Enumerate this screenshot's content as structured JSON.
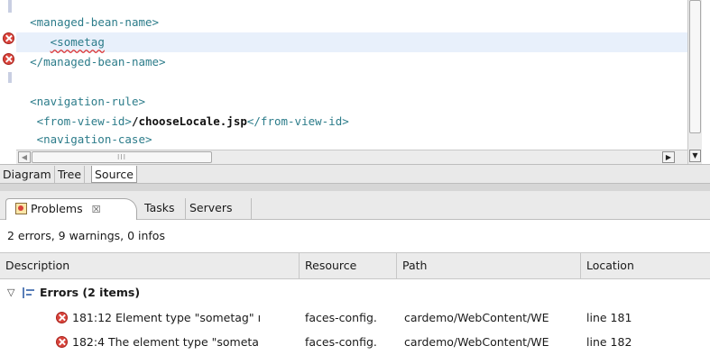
{
  "editor": {
    "lines": [
      {
        "open": "<managed-bean-name>",
        "bold": "",
        "close": ""
      },
      {
        "open": "",
        "bold": "",
        "close": "",
        "squiggle": "<sometag"
      },
      {
        "open": "</managed-bean-name>",
        "bold": "",
        "close": ""
      },
      {
        "open": "",
        "bold": "",
        "close": ""
      },
      {
        "open": "<navigation-rule>",
        "bold": "",
        "close": ""
      },
      {
        "open": "<from-view-id>",
        "bold": "/chooseLocale.jsp",
        "close": "</from-view-id>"
      },
      {
        "open": "<navigation-case>",
        "bold": "",
        "close": ""
      }
    ],
    "hscroll_grip": "III"
  },
  "editor_tabs": [
    "Diagram",
    "Tree",
    "Source"
  ],
  "view_tabs": {
    "problems": "Problems",
    "problems_close": "☒",
    "tasks": "Tasks",
    "servers": "Servers"
  },
  "problems": {
    "summary": "2 errors, 9 warnings, 0 infos",
    "columns": [
      "Description",
      "Resource",
      "Path",
      "Location"
    ],
    "group": {
      "label": "Errors (2 items)",
      "expanded": true
    },
    "rows": [
      {
        "description": "181:12 Element type \"sometag\" ı",
        "resource": "faces-config.",
        "path": "cardemo/WebContent/WE",
        "location": "line 181"
      },
      {
        "description": "182:4 The element type \"someta",
        "resource": "faces-config.",
        "path": "cardemo/WebContent/WE",
        "location": "line 182"
      }
    ]
  },
  "colors": {
    "error": "#d9433b",
    "tag": "#2c7c8a",
    "highlight_line": "#e8f0fb"
  }
}
